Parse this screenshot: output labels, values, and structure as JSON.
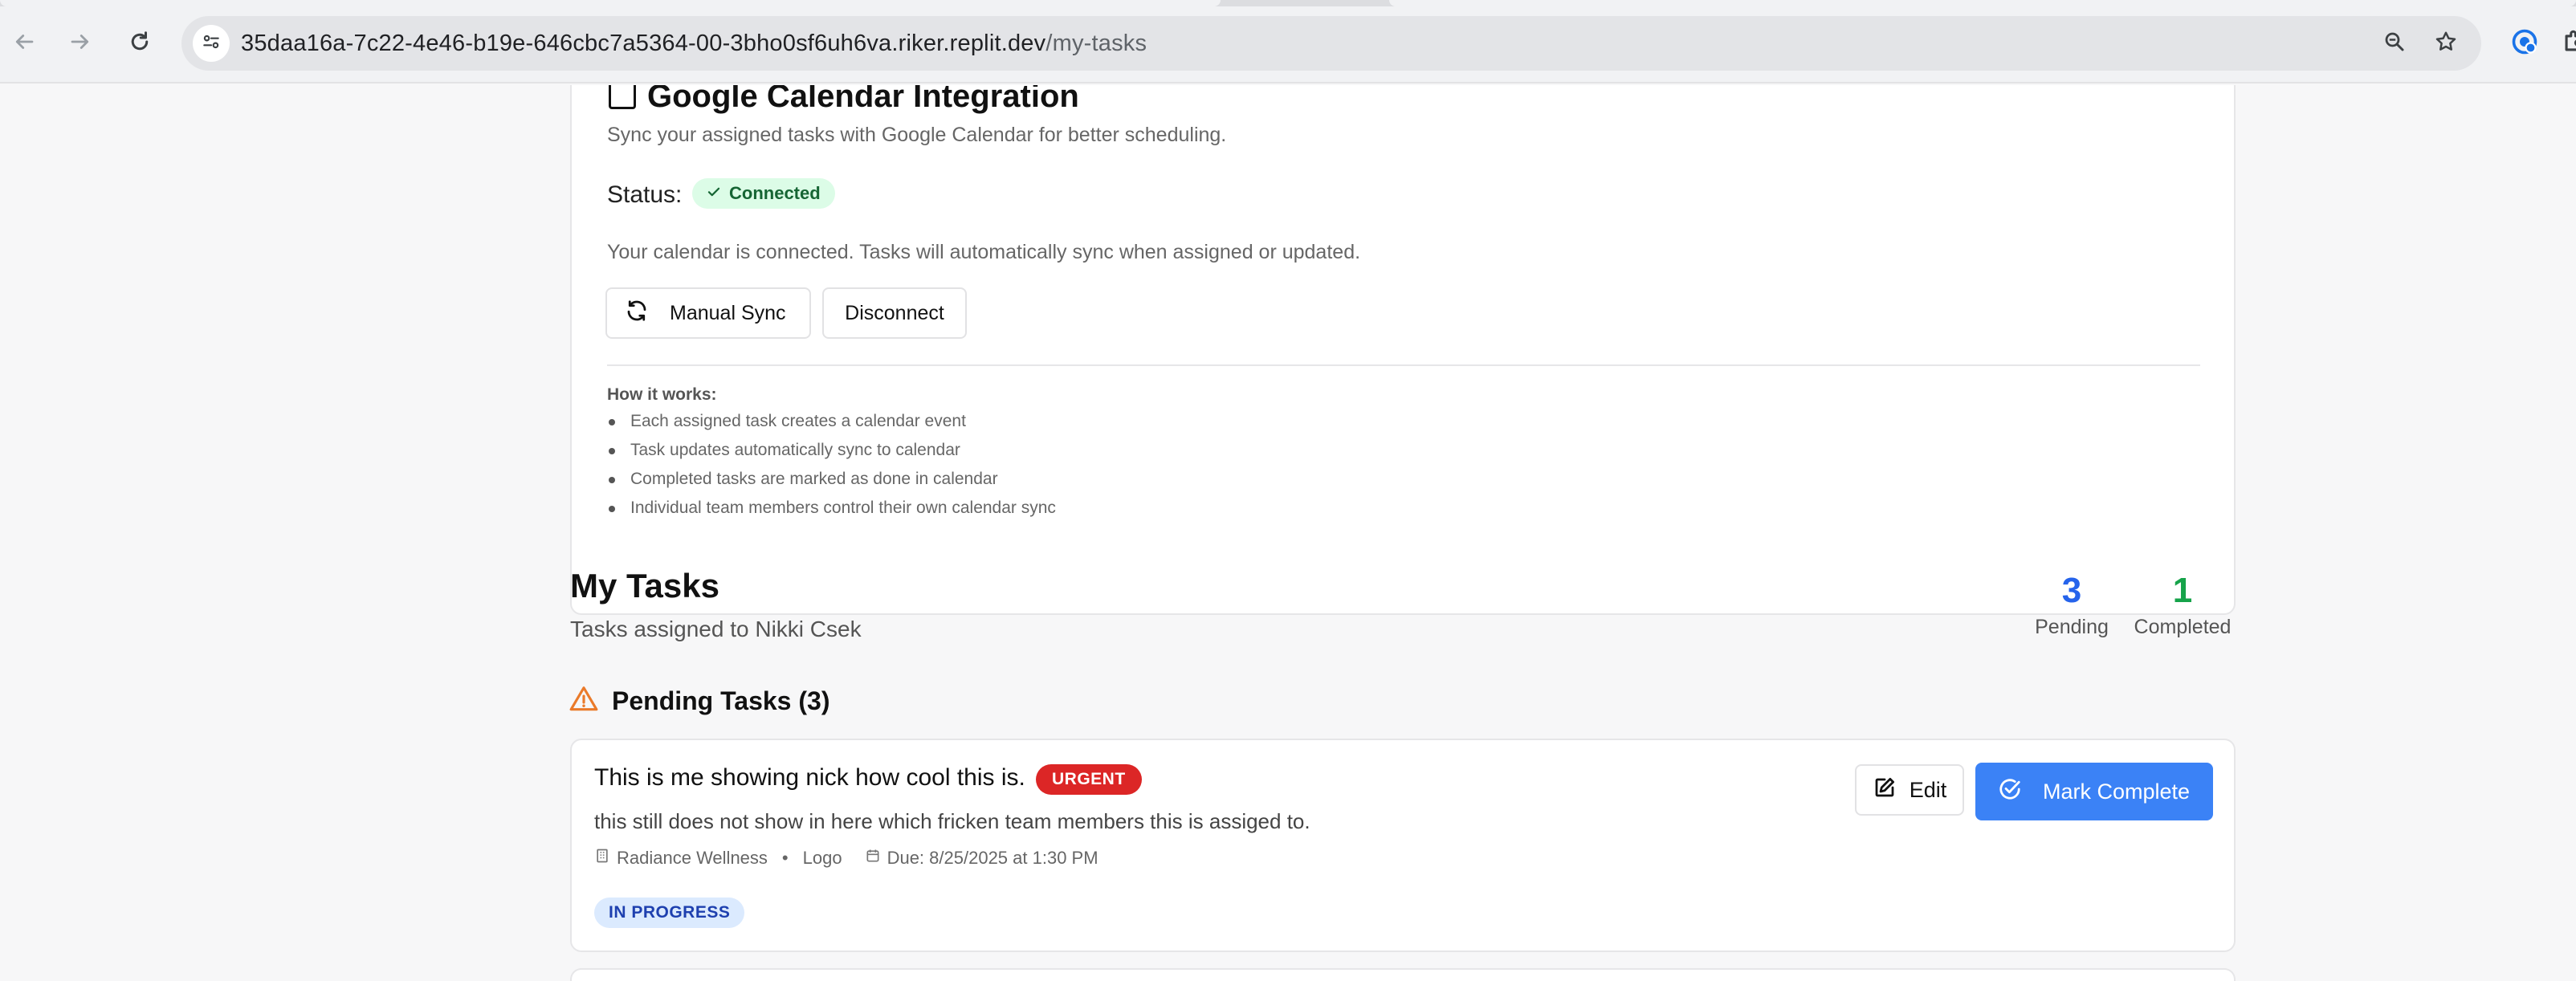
{
  "browser": {
    "url_host": "35daa16a-7c22-4e46-b19e-646cbc7a5364-00-3bho0sf6uh6va.riker.replit.dev",
    "url_path": "/my-tasks",
    "icons": [
      "back-arrow-icon",
      "forward-arrow-icon",
      "reload-icon",
      "site-settings-icon",
      "zoom-icon",
      "bookmark-star-icon",
      "extension-icon",
      "puzzle-icon"
    ]
  },
  "calendar": {
    "title": "Google Calendar Integration",
    "description": "Sync your assigned tasks with Google Calendar for better scheduling.",
    "status_label": "Status:",
    "status_value": "Connected",
    "connected_text": "Your calendar is connected. Tasks will automatically sync when assigned or updated.",
    "manual_sync_label": "Manual Sync",
    "disconnect_label": "Disconnect",
    "how_title": "How it works:",
    "how_items": [
      "Each assigned task creates a calendar event",
      "Task updates automatically sync to calendar",
      "Completed tasks are marked as done in calendar",
      "Individual team members control their own calendar sync"
    ]
  },
  "my_tasks": {
    "title": "My Tasks",
    "subtitle": "Tasks assigned to Nikki Csek",
    "pending_count": "3",
    "pending_label": "Pending",
    "completed_count": "1",
    "completed_label": "Completed",
    "pending_section_title": "Pending Tasks (3)"
  },
  "task": {
    "title": "This is me showing nick how cool this is.",
    "priority": "URGENT",
    "description": "this still does not show in here which fricken team members this is assiged to.",
    "client": "Radiance Wellness",
    "separator": "•",
    "category": "Logo",
    "due": "Due: 8/25/2025 at 1:30 PM",
    "status": "IN PROGRESS",
    "edit_label": "Edit",
    "complete_label": "Mark Complete"
  },
  "colors": {
    "accent_blue": "#3b82f6",
    "pending_blue": "#2563eb",
    "completed_green": "#16a34a",
    "urgent_red": "#dc2626",
    "connected_bg": "#dcfce7",
    "warning_orange": "#ea7a2a"
  }
}
